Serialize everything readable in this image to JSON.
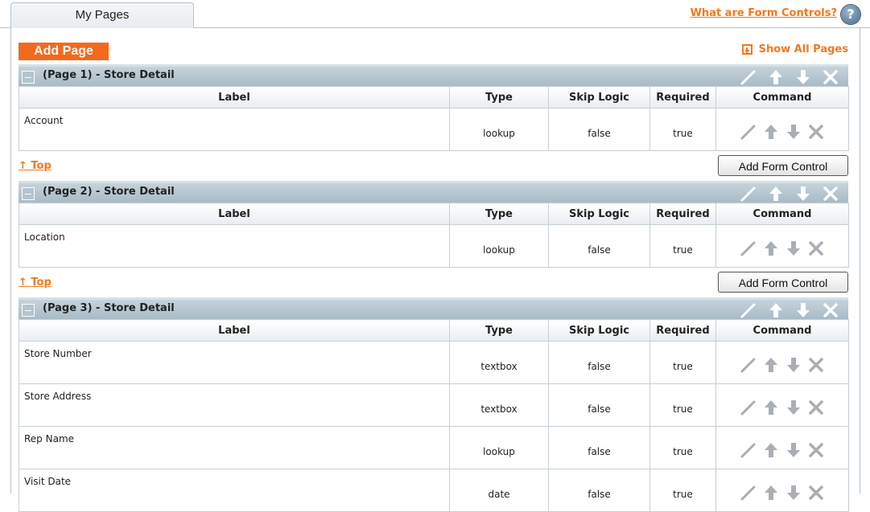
{
  "tab": {
    "title": "My Pages"
  },
  "help": {
    "link_text": "What are Form Controls?",
    "icon": "?"
  },
  "toolbar": {
    "add_page_label": "Add Page",
    "show_all_label": "Show All Pages"
  },
  "columns": {
    "label": "Label",
    "type": "Type",
    "skip_logic": "Skip Logic",
    "required": "Required",
    "command": "Command"
  },
  "footer": {
    "top_label": "↑ Top",
    "add_control_label": "Add Form Control"
  },
  "colors": {
    "accent": "#f07a20",
    "button_orange": "#f26a1e",
    "header_bar": "#a8bbc7"
  },
  "pages": [
    {
      "title": "(Page 1) - Store Detail",
      "rows": [
        {
          "label": "Account",
          "type": "lookup",
          "skip": "false",
          "required": "true"
        }
      ]
    },
    {
      "title": "(Page 2) - Store Detail",
      "rows": [
        {
          "label": "Location",
          "type": "lookup",
          "skip": "false",
          "required": "true"
        }
      ]
    },
    {
      "title": "(Page 3) - Store Detail",
      "rows": [
        {
          "label": "Store Number",
          "type": "textbox",
          "skip": "false",
          "required": "true"
        },
        {
          "label": "Store Address",
          "type": "textbox",
          "skip": "false",
          "required": "true"
        },
        {
          "label": "Rep Name",
          "type": "lookup",
          "skip": "false",
          "required": "true"
        },
        {
          "label": "Visit Date",
          "type": "date",
          "skip": "false",
          "required": "true"
        }
      ]
    }
  ]
}
